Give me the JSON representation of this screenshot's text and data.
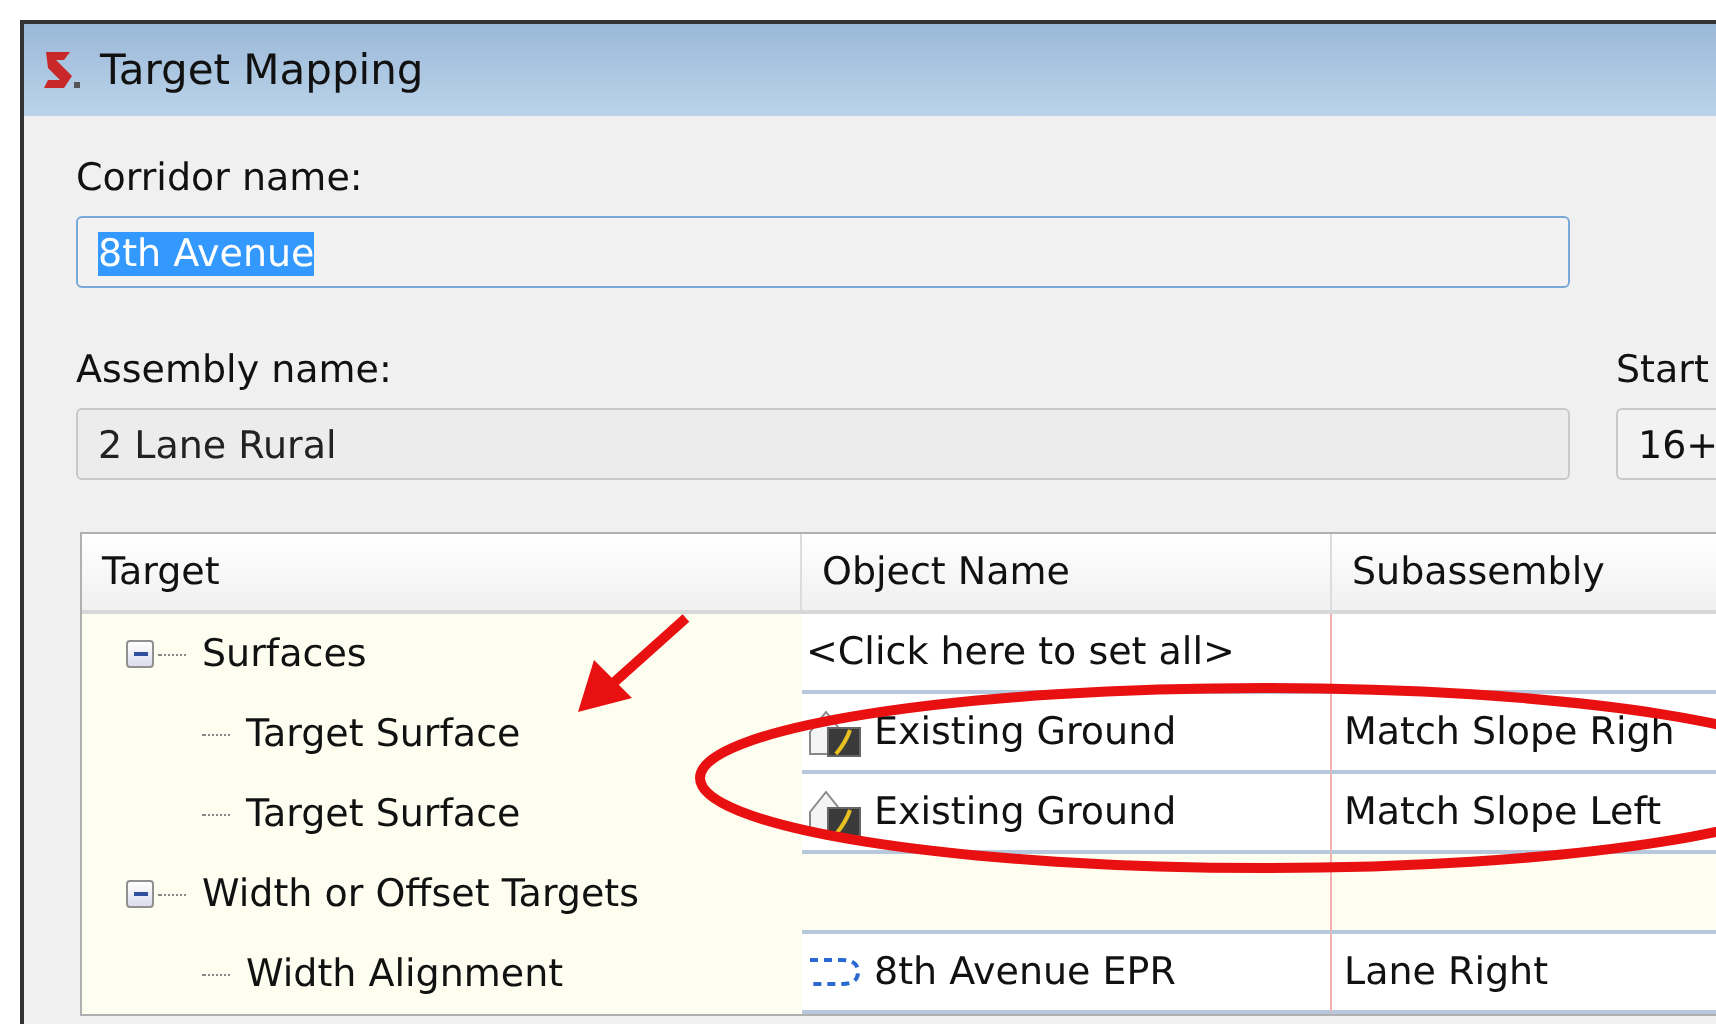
{
  "window": {
    "title": "Target Mapping"
  },
  "corridor": {
    "label": "Corridor name:",
    "value": "8th Avenue",
    "selected": true
  },
  "assembly": {
    "label": "Assembly name:",
    "value": "2 Lane Rural",
    "disabled": true
  },
  "start": {
    "label": "Start",
    "value": "16+"
  },
  "table": {
    "columns": [
      "Target",
      "Object Name",
      "Subassembly"
    ],
    "rows": [
      {
        "kind": "group",
        "target": "Surfaces",
        "expanded": true,
        "object": {
          "name": "<Click here to set all>"
        },
        "children": [
          {
            "kind": "leaf",
            "target": "Target Surface",
            "object": {
              "kind": "surface",
              "name": "Existing Ground"
            },
            "subassembly": "Match Slope Righ"
          },
          {
            "kind": "leaf",
            "target": "Target Surface",
            "object": {
              "kind": "surface",
              "name": "Existing Ground"
            },
            "subassembly": "Match Slope Left"
          }
        ]
      },
      {
        "kind": "group",
        "target": "Width or Offset Targets",
        "expanded": true,
        "children": [
          {
            "kind": "leaf",
            "target": "Width Alignment",
            "object": {
              "kind": "alignment",
              "name": "8th Avenue EPR"
            },
            "subassembly": "Lane Right"
          }
        ]
      }
    ]
  }
}
